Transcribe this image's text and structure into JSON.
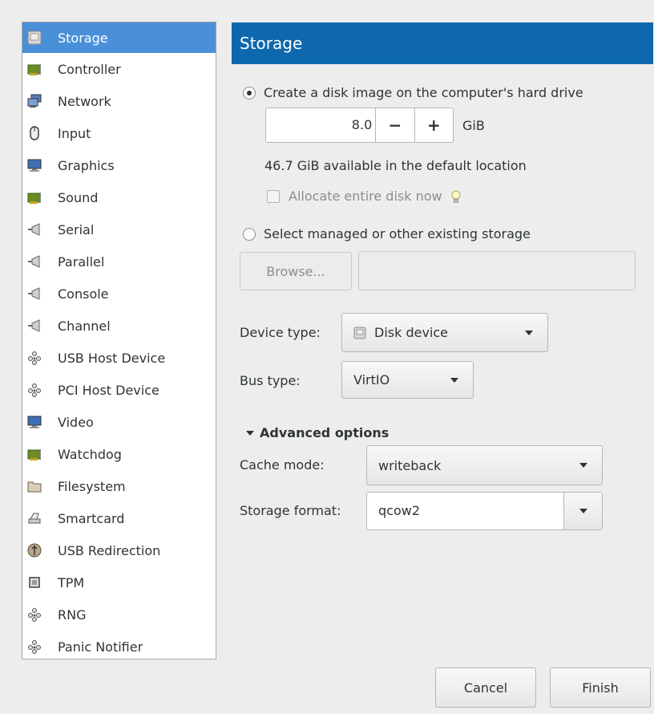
{
  "sidebar": {
    "items": [
      {
        "label": "Storage",
        "icon": "disk-icon",
        "selected": true
      },
      {
        "label": "Controller",
        "icon": "controller-card-icon"
      },
      {
        "label": "Network",
        "icon": "network-icon"
      },
      {
        "label": "Input",
        "icon": "mouse-icon"
      },
      {
        "label": "Graphics",
        "icon": "monitor-icon"
      },
      {
        "label": "Sound",
        "icon": "sound-card-icon"
      },
      {
        "label": "Serial",
        "icon": "serial-port-icon"
      },
      {
        "label": "Parallel",
        "icon": "parallel-port-icon"
      },
      {
        "label": "Console",
        "icon": "console-port-icon"
      },
      {
        "label": "Channel",
        "icon": "channel-port-icon"
      },
      {
        "label": "USB Host Device",
        "icon": "usb-device-icon"
      },
      {
        "label": "PCI Host Device",
        "icon": "pci-device-icon"
      },
      {
        "label": "Video",
        "icon": "video-monitor-icon"
      },
      {
        "label": "Watchdog",
        "icon": "watchdog-card-icon"
      },
      {
        "label": "Filesystem",
        "icon": "folder-icon"
      },
      {
        "label": "Smartcard",
        "icon": "smartcard-reader-icon"
      },
      {
        "label": "USB Redirection",
        "icon": "usb-redirection-icon"
      },
      {
        "label": "TPM",
        "icon": "chip-icon"
      },
      {
        "label": "RNG",
        "icon": "rng-device-icon"
      },
      {
        "label": "Panic Notifier",
        "icon": "panic-notifier-icon"
      }
    ]
  },
  "header": {
    "title": "Storage"
  },
  "storage": {
    "create_option_label": "Create a disk image on the computer's hard drive",
    "create_selected": true,
    "size_value": "8.0",
    "minus_label": "−",
    "plus_label": "+",
    "size_unit": "GiB",
    "available_text": "46.7 GiB available in the default location",
    "allocate_label": "Allocate entire disk now",
    "allocate_checked": false,
    "existing_option_label": "Select managed or other existing storage",
    "browse_label": "Browse...",
    "path_value": ""
  },
  "device": {
    "device_type_label": "Device type:",
    "device_type_value": "Disk device",
    "bus_type_label": "Bus type:",
    "bus_type_value": "VirtIO"
  },
  "advanced": {
    "expander_label": "Advanced options",
    "cache_mode_label": "Cache mode:",
    "cache_mode_value": "writeback",
    "storage_format_label": "Storage format:",
    "storage_format_value": "qcow2"
  },
  "buttons": {
    "cancel": "Cancel",
    "finish": "Finish"
  },
  "colors": {
    "header_bg": "#0d68ad",
    "selection_bg": "#4a90d9"
  }
}
